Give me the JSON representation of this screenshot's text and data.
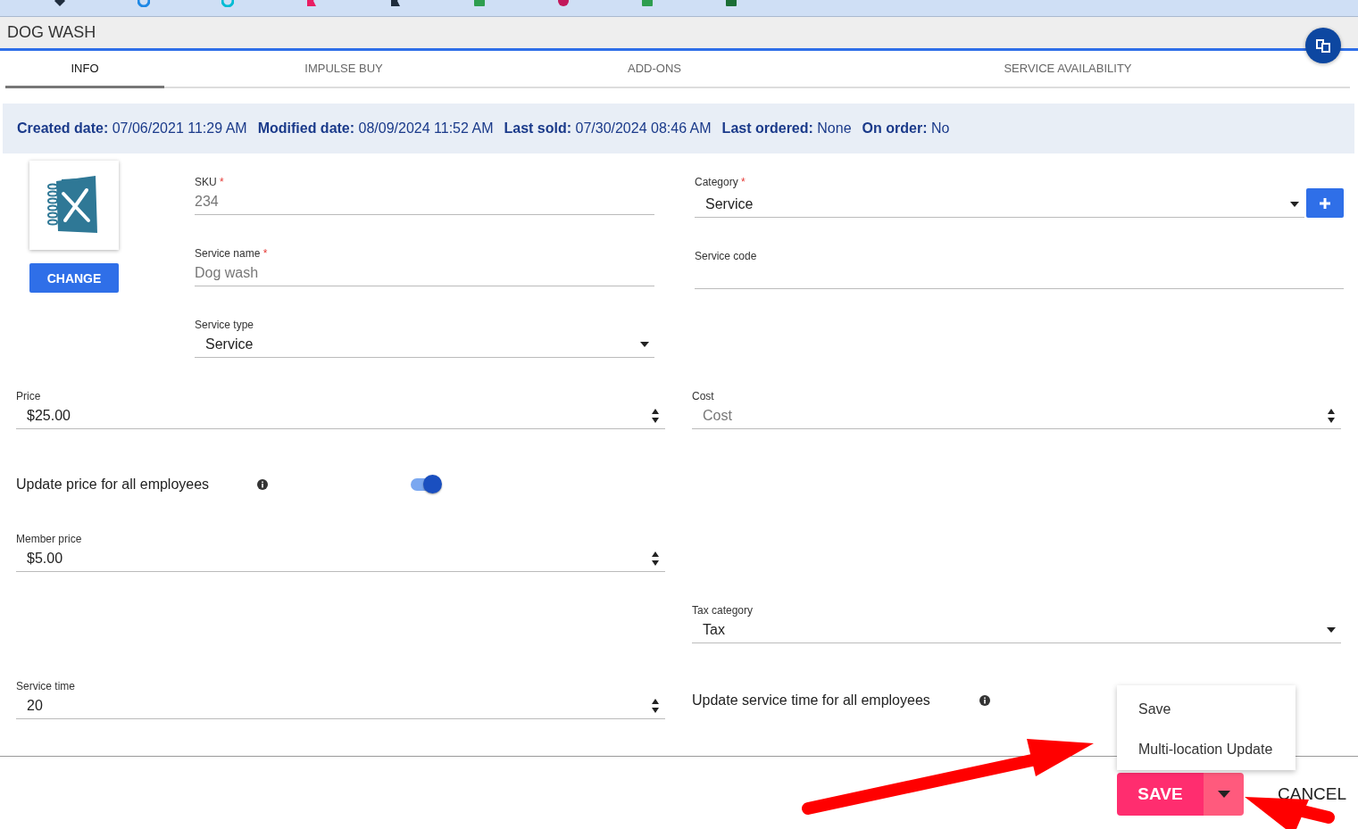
{
  "bookmarks_bar": {
    "items": [
      {
        "kind": "diamond",
        "color": "#1f2d3d"
      },
      {
        "kind": "swirl",
        "color": "#1e88e5"
      },
      {
        "kind": "swirl",
        "color": "#00bcd4"
      },
      {
        "kind": "flag",
        "color": "#e91e63"
      },
      {
        "kind": "flag",
        "color": "#1f2d3d"
      },
      {
        "kind": "sheet",
        "color": "#2e9e4f"
      },
      {
        "kind": "circle",
        "color": "#c2185b"
      },
      {
        "kind": "sheet",
        "color": "#2e9e4f"
      },
      {
        "kind": "sheet",
        "color": "#1b6e35"
      }
    ]
  },
  "header": {
    "title": "DOG WASH"
  },
  "tabs": [
    {
      "label": "INFO",
      "selected": true
    },
    {
      "label": "IMPULSE BUY",
      "selected": false
    },
    {
      "label": "ADD-ONS",
      "selected": false
    },
    {
      "label": "SERVICE AVAILABILITY",
      "selected": false
    }
  ],
  "info_bar": [
    {
      "label": "Created date:",
      "value": "07/06/2021 11:29 AM"
    },
    {
      "label": "Modified date:",
      "value": "08/09/2024 11:52 AM"
    },
    {
      "label": "Last sold:",
      "value": "07/30/2024 08:46 AM"
    },
    {
      "label": "Last ordered:",
      "value": "None"
    },
    {
      "label": "On order:",
      "value": "No"
    }
  ],
  "image_panel": {
    "button": "CHANGE"
  },
  "left_fields": [
    {
      "kind": "text",
      "label": "SKU",
      "required_mark": "*",
      "disabled": true,
      "value": "234"
    },
    {
      "kind": "text",
      "label": "Service name",
      "required_mark": "*",
      "disabled": true,
      "value": "Dog wash"
    },
    {
      "kind": "select",
      "label": "Service type",
      "value": "Service"
    }
  ],
  "right_fields": [
    {
      "kind": "select_add",
      "label": "Category",
      "required_mark": "*",
      "value": "Service"
    },
    {
      "kind": "text",
      "label": "Service code"
    }
  ],
  "rows": [
    {
      "left": {
        "kind": "number",
        "label": "Price",
        "value": "$25.00"
      },
      "right": {
        "kind": "number",
        "label": "Cost",
        "placeholder": "Cost"
      }
    },
    {
      "left": {
        "kind": "switch",
        "label": "Update price for all employees",
        "on": true
      }
    },
    {
      "left": {
        "kind": "number",
        "label": "Member price",
        "value": "$5.00"
      }
    },
    {
      "right": {
        "kind": "select",
        "label": "Tax category",
        "value": "Tax"
      }
    },
    {
      "left": {
        "kind": "number",
        "label": "Service time",
        "value": "20"
      },
      "right": {
        "kind": "note",
        "label": "Update service time for all employees"
      }
    }
  ],
  "save_menu": {
    "open": true,
    "items": [
      "Save",
      "Multi-location Update"
    ]
  },
  "footer": {
    "save": "SAVE",
    "cancel": "CANCEL"
  },
  "annotations": [
    {
      "kind": "arrow"
    },
    {
      "kind": "arrow"
    }
  ]
}
